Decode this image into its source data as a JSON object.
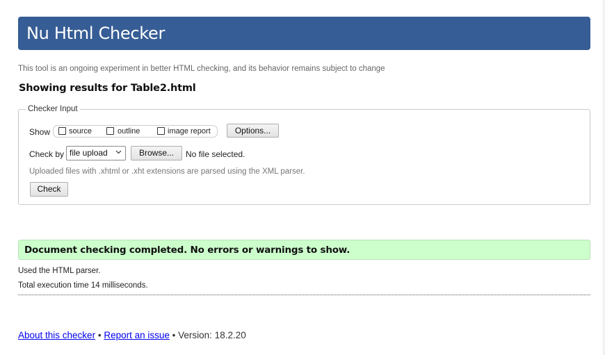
{
  "header": {
    "title": "Nu Html Checker"
  },
  "tagline": "This tool is an ongoing experiment in better HTML checking, and its behavior remains subject to change",
  "results_heading": "Showing results for Table2.html",
  "checker_input": {
    "legend": "Checker Input",
    "show_label": "Show",
    "show_options": [
      {
        "label": "source",
        "checked": false
      },
      {
        "label": "outline",
        "checked": false
      },
      {
        "label": "image report",
        "checked": false
      }
    ],
    "options_button": "Options...",
    "check_by_label": "Check by",
    "check_by_selected": "file upload",
    "browse_button": "Browse...",
    "file_status": "No file selected.",
    "parser_note": "Uploaded files with .xhtml or .xht extensions are parsed using the XML parser.",
    "check_button": "Check"
  },
  "result": {
    "message": "Document checking completed. No errors or warnings to show.",
    "parser_used": "Used the HTML parser.",
    "execution_time": "Total execution time 14 milliseconds."
  },
  "footer": {
    "about_link": "About this checker",
    "separator": "•",
    "report_link": "Report an issue",
    "version": "Version: 18.2.20"
  },
  "colors": {
    "header_bg": "#365d95",
    "success_bg": "#ccffcc",
    "link": "#0000ee"
  }
}
